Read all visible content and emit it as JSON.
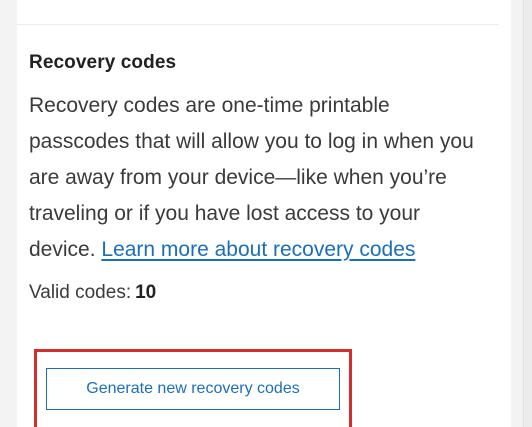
{
  "recovery": {
    "title": "Recovery codes",
    "description": "Recovery codes are one-time printable passcodes that will allow you to log in when you are away from your device—like when you’re traveling or if you have lost access to your device.",
    "learn_more_link": "Learn more about recovery codes",
    "valid_label": "Valid codes:",
    "valid_count": "10",
    "generate_button": "Generate new recovery codes"
  },
  "colors": {
    "accent": "#1b6fb9",
    "highlight": "#d32f2f",
    "text": "#3a3a3a",
    "heading": "#222222"
  }
}
